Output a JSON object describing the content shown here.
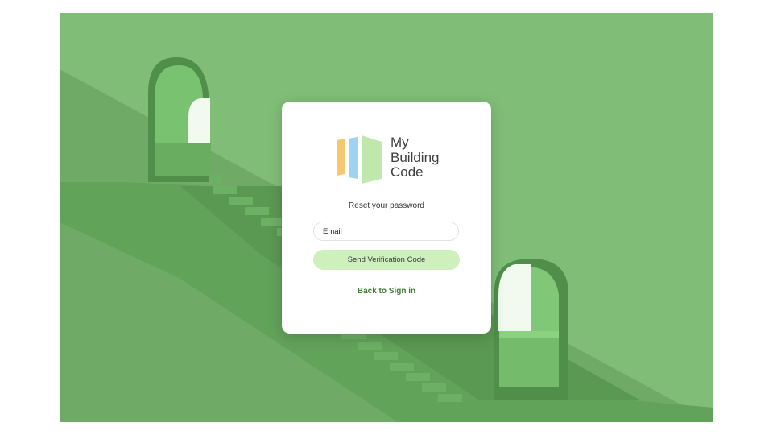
{
  "background": {
    "scene": "green-staircase-with-arches-icon",
    "colors": {
      "wall": "#7ab872",
      "stairs": "#5f9f57",
      "shadow": "#4f8c48",
      "arch_light": "#e9f7e4"
    }
  },
  "logo": {
    "icon": "book-pages-icon",
    "line1": "My",
    "line2": "Building",
    "line3": "Code",
    "colors": {
      "orange": "#f5c76f",
      "blue": "#9fd3ef",
      "green": "#bfe8ad"
    }
  },
  "form": {
    "title": "Reset your password",
    "email_placeholder": "Email",
    "email_value": "",
    "submit_label": "Send Verification Code",
    "back_link": "Back to Sign in"
  },
  "colors": {
    "accent": "#cdf0bd",
    "link": "#3f7d33",
    "card": "#ffffff"
  }
}
